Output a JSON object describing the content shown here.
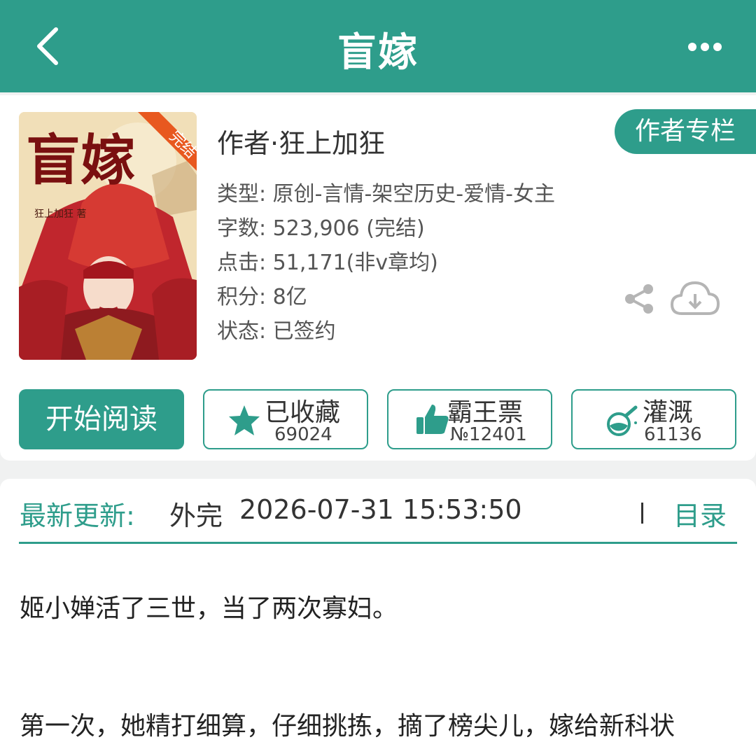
{
  "header": {
    "title": "盲嫁",
    "back_icon": "chevron-left-icon",
    "more_icon": "more-dots-icon"
  },
  "book": {
    "cover_badge": "完结",
    "cover_title": "盲嫁",
    "cover_author": "狂上加狂 著",
    "author_line": "作者·狂上加狂",
    "author_column_label": "作者专栏",
    "meta": [
      "类型: 原创-言情-架空历史-爱情-女主",
      "字数: 523,906 (完结)",
      "点击: 51,171(非v章均)",
      "积分: 8亿",
      "状态: 已签约"
    ]
  },
  "actions": {
    "read_label": "开始阅读",
    "favorite": {
      "label": "已收藏",
      "count": "69024"
    },
    "vote": {
      "label": "霸王票",
      "count": "№12401"
    },
    "nutrient": {
      "label": "灌溉",
      "count": "61136"
    }
  },
  "update": {
    "label": "最新更新:",
    "chapter": "外完",
    "time": "2026-07-31 15:53:50",
    "toc_label": "目录"
  },
  "description": [
    "姬小婵活了三世，当了两次寡妇。",
    "第一次，她精打细算，仔细挑拣，摘了榜尖儿，嫁给新科状"
  ],
  "colors": {
    "accent": "#2e9d8b",
    "background": "#f0f1f1",
    "cover_red": "#b8222a"
  }
}
